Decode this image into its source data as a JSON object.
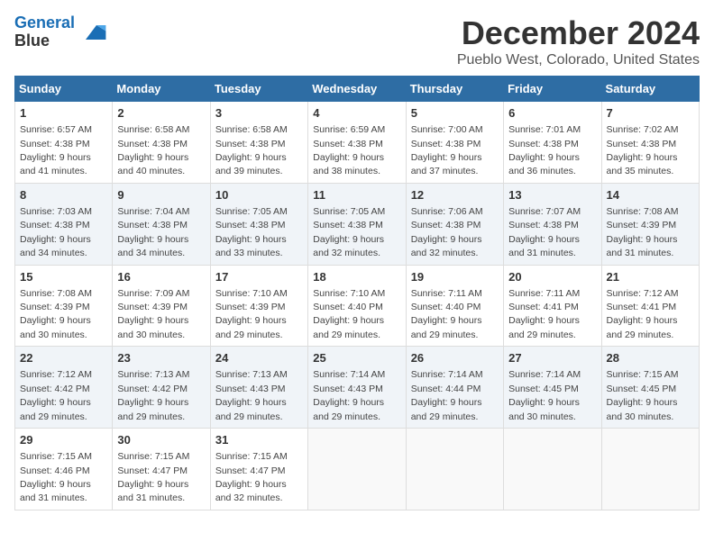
{
  "header": {
    "logo_line1": "General",
    "logo_line2": "Blue",
    "month": "December 2024",
    "location": "Pueblo West, Colorado, United States"
  },
  "days_of_week": [
    "Sunday",
    "Monday",
    "Tuesday",
    "Wednesday",
    "Thursday",
    "Friday",
    "Saturday"
  ],
  "weeks": [
    [
      {
        "day": "1",
        "sunrise": "6:57 AM",
        "sunset": "4:38 PM",
        "daylight": "9 hours and 41 minutes."
      },
      {
        "day": "2",
        "sunrise": "6:58 AM",
        "sunset": "4:38 PM",
        "daylight": "9 hours and 40 minutes."
      },
      {
        "day": "3",
        "sunrise": "6:58 AM",
        "sunset": "4:38 PM",
        "daylight": "9 hours and 39 minutes."
      },
      {
        "day": "4",
        "sunrise": "6:59 AM",
        "sunset": "4:38 PM",
        "daylight": "9 hours and 38 minutes."
      },
      {
        "day": "5",
        "sunrise": "7:00 AM",
        "sunset": "4:38 PM",
        "daylight": "9 hours and 37 minutes."
      },
      {
        "day": "6",
        "sunrise": "7:01 AM",
        "sunset": "4:38 PM",
        "daylight": "9 hours and 36 minutes."
      },
      {
        "day": "7",
        "sunrise": "7:02 AM",
        "sunset": "4:38 PM",
        "daylight": "9 hours and 35 minutes."
      }
    ],
    [
      {
        "day": "8",
        "sunrise": "7:03 AM",
        "sunset": "4:38 PM",
        "daylight": "9 hours and 34 minutes."
      },
      {
        "day": "9",
        "sunrise": "7:04 AM",
        "sunset": "4:38 PM",
        "daylight": "9 hours and 34 minutes."
      },
      {
        "day": "10",
        "sunrise": "7:05 AM",
        "sunset": "4:38 PM",
        "daylight": "9 hours and 33 minutes."
      },
      {
        "day": "11",
        "sunrise": "7:05 AM",
        "sunset": "4:38 PM",
        "daylight": "9 hours and 32 minutes."
      },
      {
        "day": "12",
        "sunrise": "7:06 AM",
        "sunset": "4:38 PM",
        "daylight": "9 hours and 32 minutes."
      },
      {
        "day": "13",
        "sunrise": "7:07 AM",
        "sunset": "4:38 PM",
        "daylight": "9 hours and 31 minutes."
      },
      {
        "day": "14",
        "sunrise": "7:08 AM",
        "sunset": "4:39 PM",
        "daylight": "9 hours and 31 minutes."
      }
    ],
    [
      {
        "day": "15",
        "sunrise": "7:08 AM",
        "sunset": "4:39 PM",
        "daylight": "9 hours and 30 minutes."
      },
      {
        "day": "16",
        "sunrise": "7:09 AM",
        "sunset": "4:39 PM",
        "daylight": "9 hours and 30 minutes."
      },
      {
        "day": "17",
        "sunrise": "7:10 AM",
        "sunset": "4:39 PM",
        "daylight": "9 hours and 29 minutes."
      },
      {
        "day": "18",
        "sunrise": "7:10 AM",
        "sunset": "4:40 PM",
        "daylight": "9 hours and 29 minutes."
      },
      {
        "day": "19",
        "sunrise": "7:11 AM",
        "sunset": "4:40 PM",
        "daylight": "9 hours and 29 minutes."
      },
      {
        "day": "20",
        "sunrise": "7:11 AM",
        "sunset": "4:41 PM",
        "daylight": "9 hours and 29 minutes."
      },
      {
        "day": "21",
        "sunrise": "7:12 AM",
        "sunset": "4:41 PM",
        "daylight": "9 hours and 29 minutes."
      }
    ],
    [
      {
        "day": "22",
        "sunrise": "7:12 AM",
        "sunset": "4:42 PM",
        "daylight": "9 hours and 29 minutes."
      },
      {
        "day": "23",
        "sunrise": "7:13 AM",
        "sunset": "4:42 PM",
        "daylight": "9 hours and 29 minutes."
      },
      {
        "day": "24",
        "sunrise": "7:13 AM",
        "sunset": "4:43 PM",
        "daylight": "9 hours and 29 minutes."
      },
      {
        "day": "25",
        "sunrise": "7:14 AM",
        "sunset": "4:43 PM",
        "daylight": "9 hours and 29 minutes."
      },
      {
        "day": "26",
        "sunrise": "7:14 AM",
        "sunset": "4:44 PM",
        "daylight": "9 hours and 29 minutes."
      },
      {
        "day": "27",
        "sunrise": "7:14 AM",
        "sunset": "4:45 PM",
        "daylight": "9 hours and 30 minutes."
      },
      {
        "day": "28",
        "sunrise": "7:15 AM",
        "sunset": "4:45 PM",
        "daylight": "9 hours and 30 minutes."
      }
    ],
    [
      {
        "day": "29",
        "sunrise": "7:15 AM",
        "sunset": "4:46 PM",
        "daylight": "9 hours and 31 minutes."
      },
      {
        "day": "30",
        "sunrise": "7:15 AM",
        "sunset": "4:47 PM",
        "daylight": "9 hours and 31 minutes."
      },
      {
        "day": "31",
        "sunrise": "7:15 AM",
        "sunset": "4:47 PM",
        "daylight": "9 hours and 32 minutes."
      },
      null,
      null,
      null,
      null
    ]
  ],
  "labels": {
    "sunrise": "Sunrise:",
    "sunset": "Sunset:",
    "daylight": "Daylight:"
  }
}
